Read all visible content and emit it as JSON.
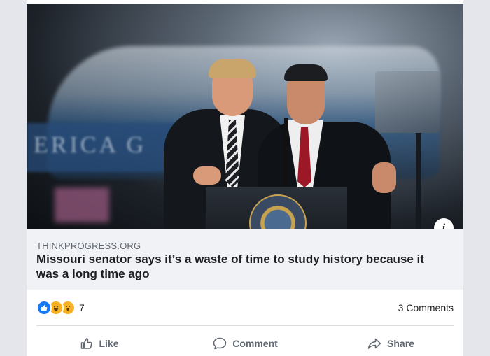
{
  "post": {
    "link": {
      "domain": "THINKPROGRESS.ORG",
      "headline": "Missouri senator says it’s a waste of time to study history because it was a long time ago"
    },
    "image": {
      "badge": "i",
      "background_text": "ERICA G"
    },
    "reactions": {
      "types": [
        "like",
        "haha",
        "wow"
      ],
      "count": "7"
    },
    "comments": "3 Comments",
    "actions": {
      "like": "Like",
      "comment": "Comment",
      "share": "Share"
    }
  },
  "colors": {
    "page_bg": "#e4e6eb",
    "link_box_bg": "#f0f2f5",
    "like_blue": "#1877f2",
    "emoji_yellow": "#f7b125",
    "muted_text": "#606770"
  }
}
